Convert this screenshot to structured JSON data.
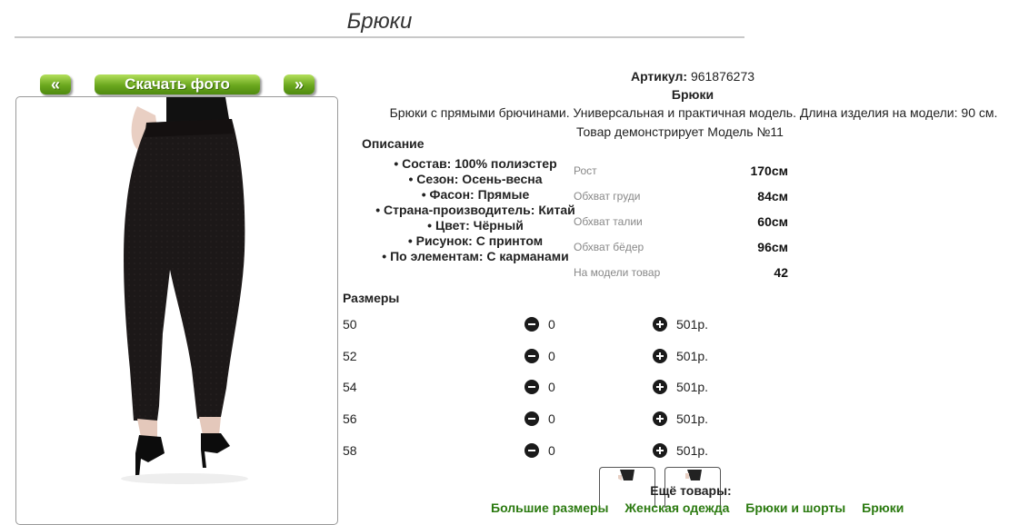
{
  "page": {
    "title": "Брюки"
  },
  "gallery": {
    "prev_label": "«",
    "download_label": "Скачать фото",
    "next_label": "»"
  },
  "product": {
    "sku_label": "Артикул:",
    "sku_value": "961876273",
    "name": "Брюки",
    "description": "Брюки с прямыми брючинами. Универсальная и практичная модель. Длина изделия на модели: 90 см.",
    "model_line": "Товар демонстрирует Модель №11"
  },
  "details": {
    "heading": "Описание",
    "features": [
      "Состав: 100% полиэстер",
      "Сезон: Осень-весна",
      "Фасон: Прямые",
      "Страна-производитель: Китай",
      "Цвет: Чёрный",
      "Рисунок: С принтом",
      "По элементам: С карманами"
    ]
  },
  "measurements": [
    {
      "label": "Рост",
      "value": "170см"
    },
    {
      "label": "Обхват груди",
      "value": "84см"
    },
    {
      "label": "Обхват талии",
      "value": "60см"
    },
    {
      "label": "Обхват бёдер",
      "value": "96см"
    },
    {
      "label": "На модели товар",
      "value": "42"
    }
  ],
  "sizes": {
    "heading": "Размеры",
    "rows": [
      {
        "size": "50",
        "qty": "0",
        "price": "501р."
      },
      {
        "size": "52",
        "qty": "0",
        "price": "501р."
      },
      {
        "size": "54",
        "qty": "0",
        "price": "501р."
      },
      {
        "size": "56",
        "qty": "0",
        "price": "501р."
      },
      {
        "size": "58",
        "qty": "0",
        "price": "501р."
      }
    ]
  },
  "more": {
    "heading": "Ещё товары:",
    "links": [
      "Большие размеры",
      "Женская одежда",
      "Брюки и шорты",
      "Брюки"
    ]
  },
  "colors": {
    "accent": "#6aa71e",
    "link": "#2b7a10"
  },
  "icons": {
    "minus": "minus-circle-icon",
    "plus": "plus-circle-icon"
  }
}
